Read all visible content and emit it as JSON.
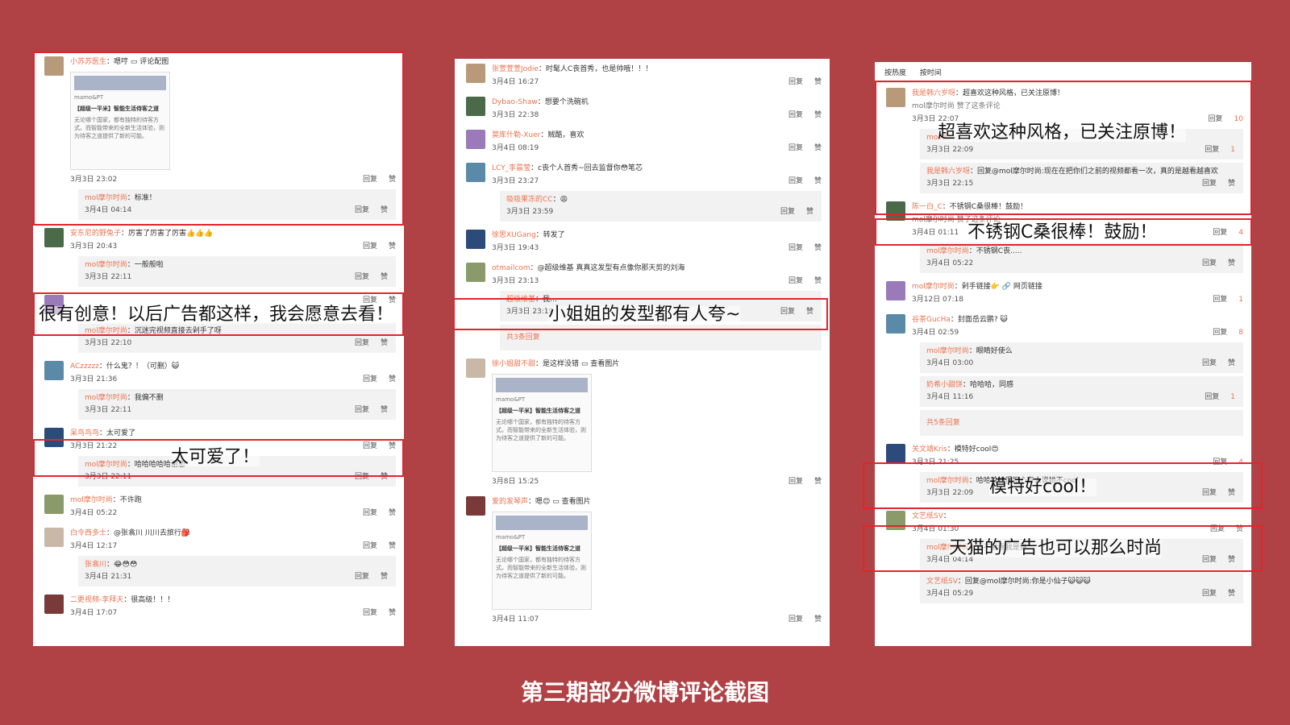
{
  "footer_title": "第三期部分微博评论截图",
  "actions": {
    "reply": "回复",
    "like": "赞"
  },
  "panel1": {
    "comments": [
      {
        "user": "小苏苏医生",
        "text": "：嗯哼 ▭ 评论配图",
        "time": "3月3日 23:02",
        "has_thumb": true,
        "thumb": {
          "brand": "mamo&PT",
          "title": "【超级一平米】智能生活侍客之道",
          "body": "无论哪个国家，都有独特的待客方式。而智能带来的全新生活体验，则为待客之道提供了新的可能。"
        },
        "replies": [
          {
            "user": "mol摩尔时尚",
            "text": "：标准！",
            "time": "3月4日 04:14"
          }
        ]
      },
      {
        "user": "安东尼的野兔子",
        "text": "：厉害了厉害了厉害👍👍👍",
        "time": "3月3日 20:43",
        "replies": [
          {
            "user": "mol摩尔时尚",
            "text": "：一般般啦",
            "time": "3月3日 22:11"
          }
        ]
      },
      {
        "user": "",
        "text": "",
        "time": "",
        "replies": [
          {
            "user": "mol摩尔时尚",
            "text": "：沉迷完视频直接去剁手了呀",
            "time": "3月3日 22:10"
          }
        ]
      },
      {
        "user": "ACzzzzz",
        "text": "：什么鬼？！（可删）😺",
        "time": "3月3日 21:36",
        "replies": [
          {
            "user": "mol摩尔时尚",
            "text": "：我偏不删",
            "time": "3月3日 22:11"
          }
        ]
      },
      {
        "user": "呆鸟鸟鸟",
        "text": "：太可爱了",
        "time": "3月3日 21:22",
        "replies": [
          {
            "user": "mol摩尔时尚",
            "text": "：哈哈哈哈哈谢您",
            "time": "3月3日 22:11"
          }
        ]
      },
      {
        "user": "mol摩尔时尚",
        "text": "：不许跑",
        "time": "3月4日 05:22",
        "replies": []
      },
      {
        "user": "白令西多士",
        "text": "：@张翕川 川川去旅行🎒",
        "time": "3月4日 12:17",
        "replies": [
          {
            "user": "张翕川",
            "text": "：😂😳😳",
            "time": "3月4日 21:31"
          }
        ]
      },
      {
        "user": "二更视频-李拜天",
        "text": "：很高级！！！",
        "time": "3月4日 17:07",
        "replies": []
      }
    ],
    "captions": [
      "很有创意！以后广告都这样，我会愿意去看！",
      "太可爱了！"
    ]
  },
  "panel2": {
    "comments": [
      {
        "user": "张萱萱萱Jodie",
        "text": "：时髦人C丧首秀，也是帅哦！！！",
        "time": "3月4日 16:27",
        "replies": []
      },
      {
        "user": "Dybao-Shaw",
        "text": "：想要个洗碗机",
        "time": "3月3日 22:38",
        "replies": []
      },
      {
        "user": "莫库什勒-Xuer",
        "text": "：贼酷，喜欢",
        "time": "3月4日 08:19",
        "replies": []
      },
      {
        "user": "LCY_李晨莹",
        "text": "：c丧个人首秀~回去监督你😳笔芯",
        "time": "3月3日 23:27",
        "replies": [
          {
            "user": "吸吸果冻的CC",
            "text": "：😩",
            "time": "3月3日 23:59"
          }
        ]
      },
      {
        "user": "徐思XUGang",
        "text": "：转发了",
        "time": "3月3日 19:43",
        "replies": []
      },
      {
        "user": "otmailcom",
        "text": "：@超级维基 真真这发型有点像你那天剪的刘海",
        "time": "3月3日 23:13",
        "replies": [
          {
            "user": "超级维基",
            "text": "：我…",
            "time": "3月3日 23:19"
          }
        ],
        "more": "共3条回复"
      },
      {
        "user": "徐小姐甜不甜",
        "text": "：是这样没错 ▭ 查看图片",
        "time": "3月8日 15:25",
        "has_thumb": true,
        "thumb": {
          "brand": "mamo&PT",
          "title": "【超级一平米】智能生活侍客之道",
          "body": "无论哪个国家，都有独特的待客方式。而智能带来的全新生活体验，则为待客之道提供了新的可能。"
        },
        "replies": []
      },
      {
        "user": "爱的发琴声",
        "text": "：嗯😊 ▭ 查看图片",
        "time": "3月4日 11:07",
        "has_thumb": true,
        "thumb": {
          "brand": "mamo&PT",
          "title": "【超级一平米】智能生活侍客之道",
          "body": "无论哪个国家，都有独特的待客方式。而智能带来的全新生活体验，则为待客之道提供了新的可能。"
        },
        "replies": []
      }
    ],
    "captions": [
      "小姐姐的发型都有人夸~"
    ]
  },
  "panel3": {
    "tabs": [
      "按热度",
      "按时间"
    ],
    "comments": [
      {
        "user": "我是韩六岁呀",
        "text": "：超喜欢这种风格，已关注原博！",
        "time": "3月3日 22:07",
        "likes": "10",
        "liked_by": "mol摩尔时尚 赞了这条评论",
        "replies": [
          {
            "user": "mol摩",
            "text": "",
            "time": "3月3日 22:09",
            "likes": "1"
          },
          {
            "user": "我是韩六岁呀",
            "text": "：回复@mol摩尔时尚:现在在把你们之前的视频都看一次，真的是越看越喜欢",
            "time": "3月3日 22:15"
          }
        ]
      },
      {
        "user": "陈一白_C",
        "text": "：不锈钢C桑很棒！鼓励！",
        "time": "3月4日 01:11",
        "likes": "4",
        "liked_by": "mol摩尔时尚 赞了这条评论",
        "replies": [
          {
            "user": "mol摩尔时尚",
            "text": "：不锈钢C丧.....",
            "time": "3月4日 05:22"
          }
        ]
      },
      {
        "user": "mol摩尔时尚",
        "text": "：剁手链接👉 🔗 网页链接",
        "time": "3月12日 07:18",
        "likes": "1",
        "replies": []
      },
      {
        "user": "谷茶GucHa",
        "text": "：封面岳云鹏? 😺",
        "time": "3月4日 02:59",
        "likes": "8",
        "replies": [
          {
            "user": "mol摩尔时尚",
            "text": "：眼睛好使么",
            "time": "3月4日 03:00"
          },
          {
            "user": "奶希小甜饼",
            "text": "：哈哈哈，同感",
            "time": "3月4日 11:16",
            "likes": "1"
          }
        ],
        "more": "共5条回复"
      },
      {
        "user": "关文靖Kris",
        "text": "：模特好cool😍",
        "time": "3月3日 21:25",
        "likes": "4",
        "replies": [
          {
            "user": "mol摩尔时尚",
            "text": "：哈哈哈她很担心有人说她不cool",
            "time": "3月3日 22:09"
          }
        ]
      },
      {
        "user": "文艺纸SV",
        "text": "：",
        "time": "3月4日 01:30",
        "replies": [
          {
            "user": "mol摩尔时尚",
            "text": "：也不看看我是谁",
            "time": "3月4日 04:14"
          },
          {
            "user": "文艺纸SV",
            "text": "：回复@mol摩尔时尚:你是小仙子😺😺😺",
            "time": "3月4日 05:29"
          }
        ]
      }
    ],
    "captions": [
      "超喜欢这种风格，已关注原博！",
      "不锈钢C桑很棒！鼓励！",
      "模特好cool！",
      "天猫的广告也可以那么时尚"
    ]
  }
}
